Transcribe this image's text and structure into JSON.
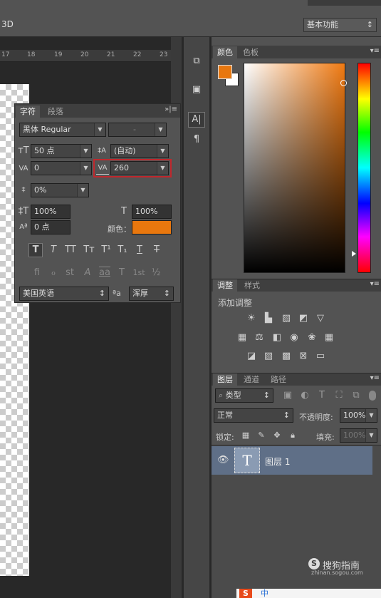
{
  "menubar": {
    "label": "3D",
    "workspace": "基本功能"
  },
  "ruler": {
    "marks": [
      "17",
      "18",
      "19",
      "20",
      "21",
      "22",
      "23"
    ]
  },
  "char_panel": {
    "tabs": [
      "字符",
      "段落"
    ],
    "font_family": "黑体 Regular",
    "font_style": "-",
    "font_size": "50 点",
    "leading": "(自动)",
    "kerning": "0",
    "tracking": "260",
    "vscale": "0%",
    "hscale_v": "100%",
    "hscale_h": "100%",
    "baseline": "0 点",
    "color_label": "颜色：",
    "color_value": "#e8770e",
    "style_buttons": [
      "T",
      "T",
      "TT",
      "Tт",
      "T¹",
      "T₁",
      "T",
      "T"
    ],
    "opentype_buttons": [
      "fi",
      "ℴ",
      "st",
      "A",
      "aa",
      "T",
      "1st",
      "½"
    ],
    "language": "美国英语",
    "aa_label": "ªa",
    "aa_mode": "浑厚"
  },
  "color_panel": {
    "tabs": [
      "颜色",
      "色板"
    ],
    "fg": "#e8770e",
    "bg": "#ffffff",
    "field_hue": "#f07a12"
  },
  "adjust_panel": {
    "tabs": [
      "调整",
      "样式"
    ],
    "title": "添加调整"
  },
  "layers_panel": {
    "tabs": [
      "图层",
      "通道",
      "路径"
    ],
    "filter_kind": "类型",
    "blend_mode": "正常",
    "opacity_label": "不透明度:",
    "opacity": "100%",
    "lock_label": "锁定:",
    "fill_label": "填充:",
    "fill": "100%",
    "layers": [
      {
        "name": "图层 1",
        "thumb": "T",
        "visible": true
      }
    ]
  },
  "watermark": {
    "brand": "搜狗指南",
    "site": "zhinan.sogou.com"
  },
  "taskbar": {
    "logo": "S",
    "text": "中"
  }
}
